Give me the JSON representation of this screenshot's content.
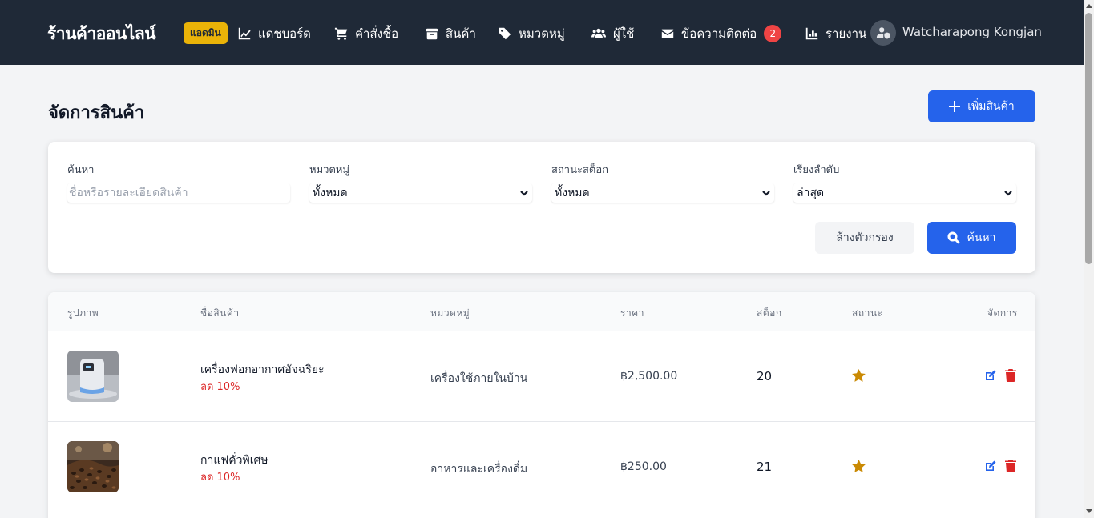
{
  "header": {
    "brand": "ร้านค้าออนไลน์",
    "badge": "แอดมิน",
    "nav": [
      {
        "label": "แดชบอร์ด",
        "icon": "chart-line-icon"
      },
      {
        "label": "คำสั่งซื้อ",
        "icon": "cart-icon"
      },
      {
        "label": "สินค้า",
        "icon": "box-icon"
      },
      {
        "label": "หมวดหมู่",
        "icon": "tag-icon"
      },
      {
        "label": "ผู้ใช้",
        "icon": "users-icon"
      },
      {
        "label": "ข้อความติดต่อ",
        "icon": "envelope-icon",
        "count": "2"
      },
      {
        "label": "รายงาน",
        "icon": "chart-bar-icon"
      }
    ],
    "user_name": "Watcharapong Kongjan"
  },
  "page": {
    "title": "จัดการสินค้า",
    "add_button": "เพิ่มสินค้า"
  },
  "filters": {
    "search_label": "ค้นหา",
    "search_placeholder": "ชื่อหรือรายละเอียดสินค้า",
    "search_value": "",
    "category_label": "หมวดหมู่",
    "category_value": "ทั้งหมด",
    "stock_label": "สถานะสต็อก",
    "stock_value": "ทั้งหมด",
    "sort_label": "เรียงลำดับ",
    "sort_value": "ล่าสุด",
    "clear_button": "ล้างตัวกรอง",
    "search_button": "ค้นหา"
  },
  "table": {
    "headers": {
      "image": "รูปภาพ",
      "name": "ชื่อสินค้า",
      "category": "หมวดหมู่",
      "price": "ราคา",
      "stock": "สต็อก",
      "status": "สถานะ",
      "actions": "จัดการ"
    },
    "rows": [
      {
        "name": "เครื่องฟอกอากาศอัจฉริยะ",
        "discount": "ลด 10%",
        "category": "เครื่องใช้ภายในบ้าน",
        "price": "฿2,500.00",
        "stock": "20",
        "status_icon": "star-icon"
      },
      {
        "name": "กาแฟคั่วพิเศษ",
        "discount": "ลด 10%",
        "category": "อาหารและเครื่องดื่ม",
        "price": "฿250.00",
        "stock": "21",
        "status_icon": "star-icon"
      }
    ]
  },
  "colors": {
    "navbar": "#1f2937",
    "accent": "#2563eb",
    "badge": "#eab308",
    "danger": "#dc2626",
    "star": "#ca8a04"
  }
}
